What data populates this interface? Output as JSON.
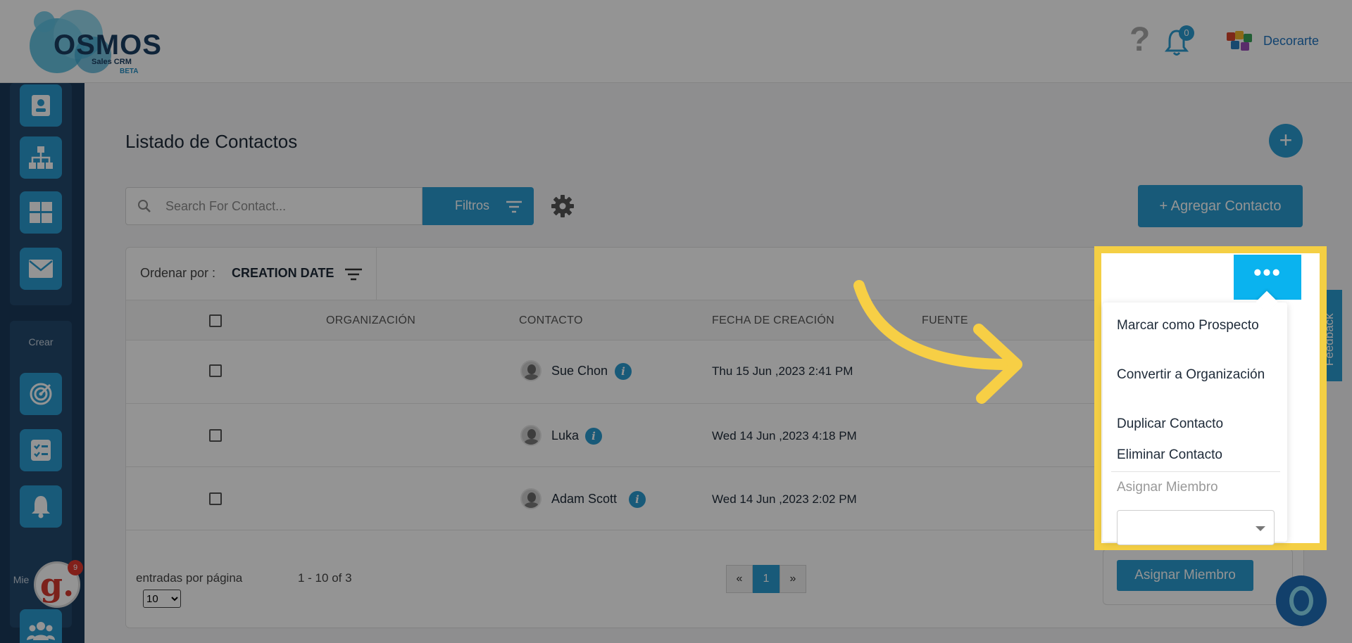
{
  "header": {
    "logo_text": "OSMOS",
    "logo_sub": "Sales CRM",
    "logo_beta": "BETA",
    "help_icon": "question-icon",
    "notifications_count": "0",
    "company_name": "Decorarte"
  },
  "sidebar": {
    "items": [
      {
        "icon": "contact-card-icon"
      },
      {
        "icon": "org-chart-icon"
      },
      {
        "icon": "grid-icon"
      },
      {
        "icon": "mail-icon"
      }
    ],
    "create_label": "Crear",
    "create_items": [
      {
        "icon": "target-icon"
      },
      {
        "icon": "checklist-icon"
      },
      {
        "icon": "bell-icon"
      }
    ],
    "members_label": "Mie",
    "members_icon": "users-icon",
    "g_badge": "9",
    "g_letter": "g."
  },
  "main": {
    "title": "Listado de Contactos",
    "add_circle": "+",
    "search_placeholder": "Search For Contact...",
    "filter_label": "Filtros",
    "add_contact_label": "+ Agregar Contacto",
    "sort_label": "Ordenar por :",
    "sort_value": "CREATION DATE",
    "columns": [
      "ORGANIZACIÓN",
      "CONTACTO",
      "FECHA DE CREACIÓN",
      "FUENTE"
    ],
    "rows": [
      {
        "contact": "Sue Chon",
        "date": "Thu 15 Jun ,2023 2:41 PM"
      },
      {
        "contact": "Luka",
        "date": "Wed 14 Jun ,2023 4:18 PM"
      },
      {
        "contact": "Adam Scott",
        "date": "Wed 14 Jun ,2023 2:02 PM"
      }
    ],
    "per_page_label": "entradas por página",
    "per_page_value": "10",
    "range_text": "1 - 10 of 3",
    "pager": {
      "prev": "«",
      "current": "1",
      "next": "»"
    }
  },
  "dropdown": {
    "dots": "•••",
    "items": [
      "Marcar como Prospecto",
      "Convertir a Organización",
      "Duplicar Contacto",
      "Eliminar Contacto"
    ],
    "assign_label": "Asignar Miembro",
    "assign_button": "Asignar Miembro"
  },
  "feedback": "Feedback",
  "colors": {
    "accent": "#2a9bd0",
    "highlight": "#f4cf44",
    "sidebar": "#1b3a5a",
    "dots_button": "#0ab3ef"
  }
}
